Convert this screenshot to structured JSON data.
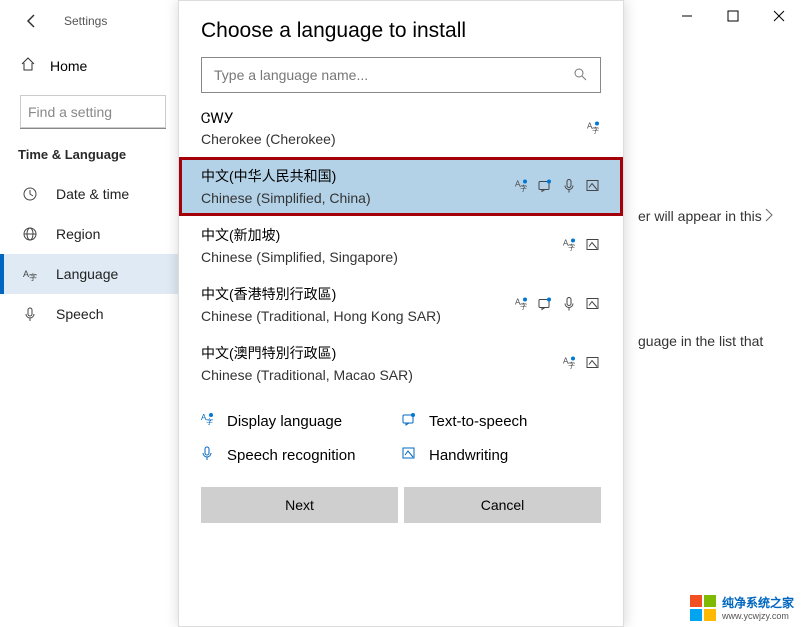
{
  "titlebar": {
    "label": "Settings"
  },
  "sidebar": {
    "home": "Home",
    "search_placeholder": "Find a setting",
    "section": "Time & Language",
    "items": [
      {
        "label": "Date & time",
        "icon": "clock"
      },
      {
        "label": "Region",
        "icon": "globe"
      },
      {
        "label": "Language",
        "icon": "lang",
        "active": true
      },
      {
        "label": "Speech",
        "icon": "mic"
      }
    ]
  },
  "background": {
    "hint1": "er will appear in this",
    "hint2": "guage in the list that"
  },
  "dialog": {
    "title": "Choose a language to install",
    "search_placeholder": "Type a language name...",
    "languages": [
      {
        "native": "ᏣᎳᎩ",
        "english": "Cherokee (Cherokee)",
        "features": [
          "display"
        ]
      },
      {
        "native": "中文(中华人民共和国)",
        "english": "Chinese (Simplified, China)",
        "features": [
          "display",
          "tts",
          "speech",
          "hand"
        ],
        "selected": true
      },
      {
        "native": "中文(新加坡)",
        "english": "Chinese (Simplified, Singapore)",
        "features": [
          "display",
          "hand"
        ]
      },
      {
        "native": "中文(香港特別行政區)",
        "english": "Chinese (Traditional, Hong Kong SAR)",
        "features": [
          "display",
          "tts",
          "speech",
          "hand"
        ]
      },
      {
        "native": "中文(澳門特別行政區)",
        "english": "Chinese (Traditional, Macao SAR)",
        "features": [
          "display",
          "hand"
        ]
      }
    ],
    "legend": {
      "display": "Display language",
      "tts": "Text-to-speech",
      "speech": "Speech recognition",
      "hand": "Handwriting"
    },
    "next": "Next",
    "cancel": "Cancel"
  },
  "watermark": {
    "line1": "纯净系统之家",
    "line2": "www.ycwjzy.com"
  }
}
